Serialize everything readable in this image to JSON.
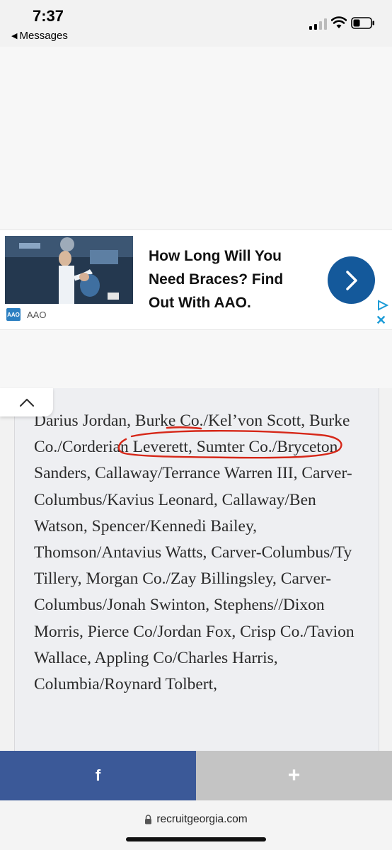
{
  "status_bar": {
    "time": "7:37",
    "back_label": "Messages"
  },
  "ad": {
    "headline": "How Long Will You Need Braces? Find Out With AAO.",
    "brand": "AAO",
    "logo_text": "AAO",
    "accent_color": "#14599b"
  },
  "article": {
    "text": "Darius Jordan, Burke Co./Kel’von Scott, Burke Co./Corderian Leverett, Sumter Co./Bryceton Sanders, Callaway/Terrance Warren III, Carver-Columbus/Kavius Leonard, Callaway/Ben Watson, Spencer/Kennedi Bailey, Thomson/Antavius Watts, Carver-Columbus/Ty Tillery, Morgan Co./Zay Billingsley, Carver-Columbus/Jonah Swinton, Stephens//Dixon Morris, Pierce Co/Jordan Fox, Crisp Co./Tavion Wallace, Appling Co/Charles Harris, Columbia/Roynard Tolbert,"
  },
  "share_bar": {
    "facebook_icon": "f",
    "plus_icon": "+",
    "facebook_color": "#3b5998",
    "plus_color": "#c4c4c4"
  },
  "browser": {
    "url": "recruitgeorgia.com",
    "lock_icon": "lock-icon"
  }
}
